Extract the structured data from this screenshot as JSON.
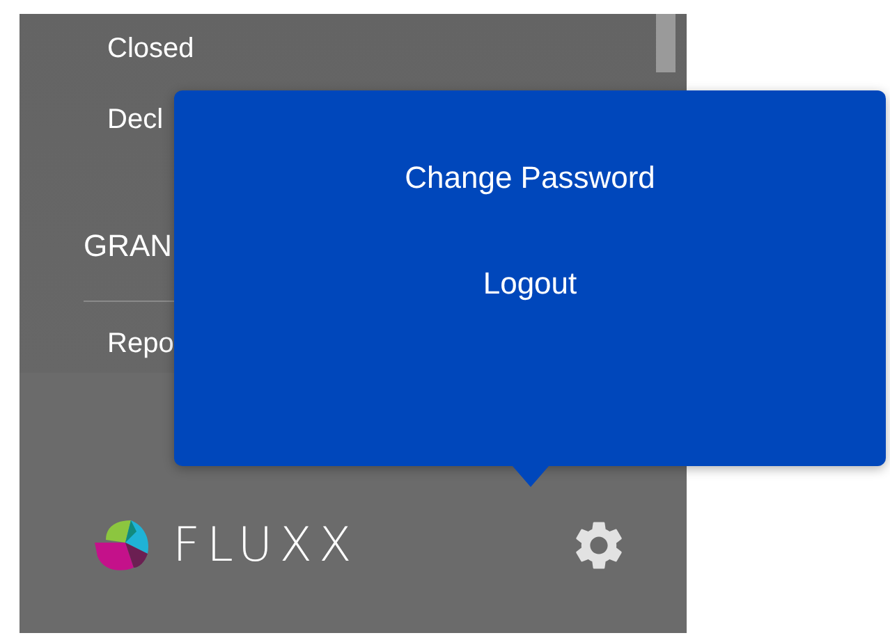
{
  "sidebar": {
    "items": [
      {
        "kind": "link",
        "label": "Closed"
      },
      {
        "kind": "link",
        "label": "Decl"
      },
      {
        "kind": "heading",
        "label": "GRAN"
      },
      {
        "kind": "link",
        "label": "Repo"
      }
    ]
  },
  "logo": {
    "text": "FLUXX"
  },
  "popup_menu": {
    "items": [
      {
        "label": "Change Password"
      },
      {
        "label": "Logout"
      }
    ]
  }
}
